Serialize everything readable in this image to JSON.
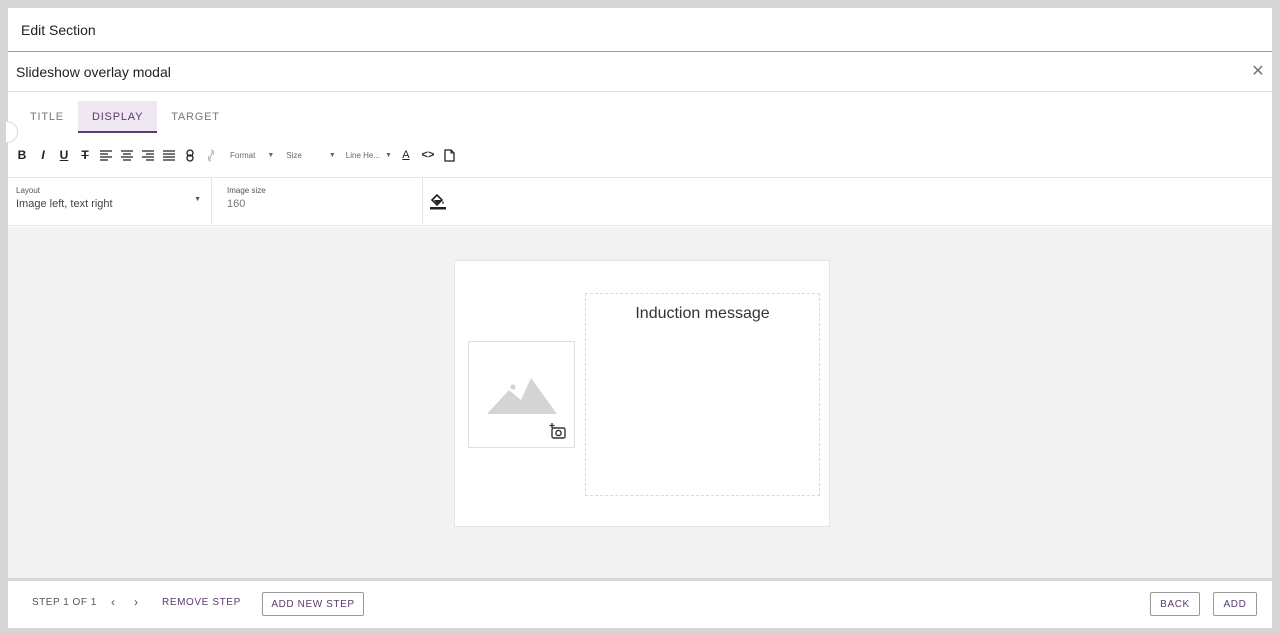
{
  "header": {
    "title": "Edit Section"
  },
  "modal": {
    "title": "Slideshow overlay modal",
    "close_glyph": "✕"
  },
  "tabs": [
    {
      "label": "TITLE",
      "active": false
    },
    {
      "label": "DISPLAY",
      "active": true
    },
    {
      "label": "TARGET",
      "active": false
    }
  ],
  "toolbar": {
    "bold": "B",
    "italic": "I",
    "underline": "U",
    "strike": "T",
    "format_label": "Format",
    "size_label": "Size",
    "line_height_label": "Line He...",
    "font_color_glyph": "A",
    "code_glyph": "<>",
    "icons": [
      "align-left-icon",
      "align-center-icon",
      "align-right-icon",
      "align-justify-icon",
      "link-icon",
      "unlink-icon",
      "font-color-icon",
      "code-view-icon",
      "document-icon"
    ]
  },
  "options": {
    "layout_label": "Layout",
    "layout_value": "Image left, text right",
    "image_size_label": "Image size",
    "image_size_value": "160"
  },
  "preview": {
    "message": "Induction message"
  },
  "footer": {
    "step_label": "STEP 1 OF 1",
    "prev_glyph": "‹",
    "next_glyph": "›",
    "remove_step": "REMOVE STEP",
    "add_new_step": "ADD NEW STEP",
    "back": "BACK",
    "add": "ADD"
  },
  "colors": {
    "accent": "#5b3a6e",
    "tab_active_bg": "#efe8f2",
    "canvas_bg": "#f2f2f2"
  }
}
